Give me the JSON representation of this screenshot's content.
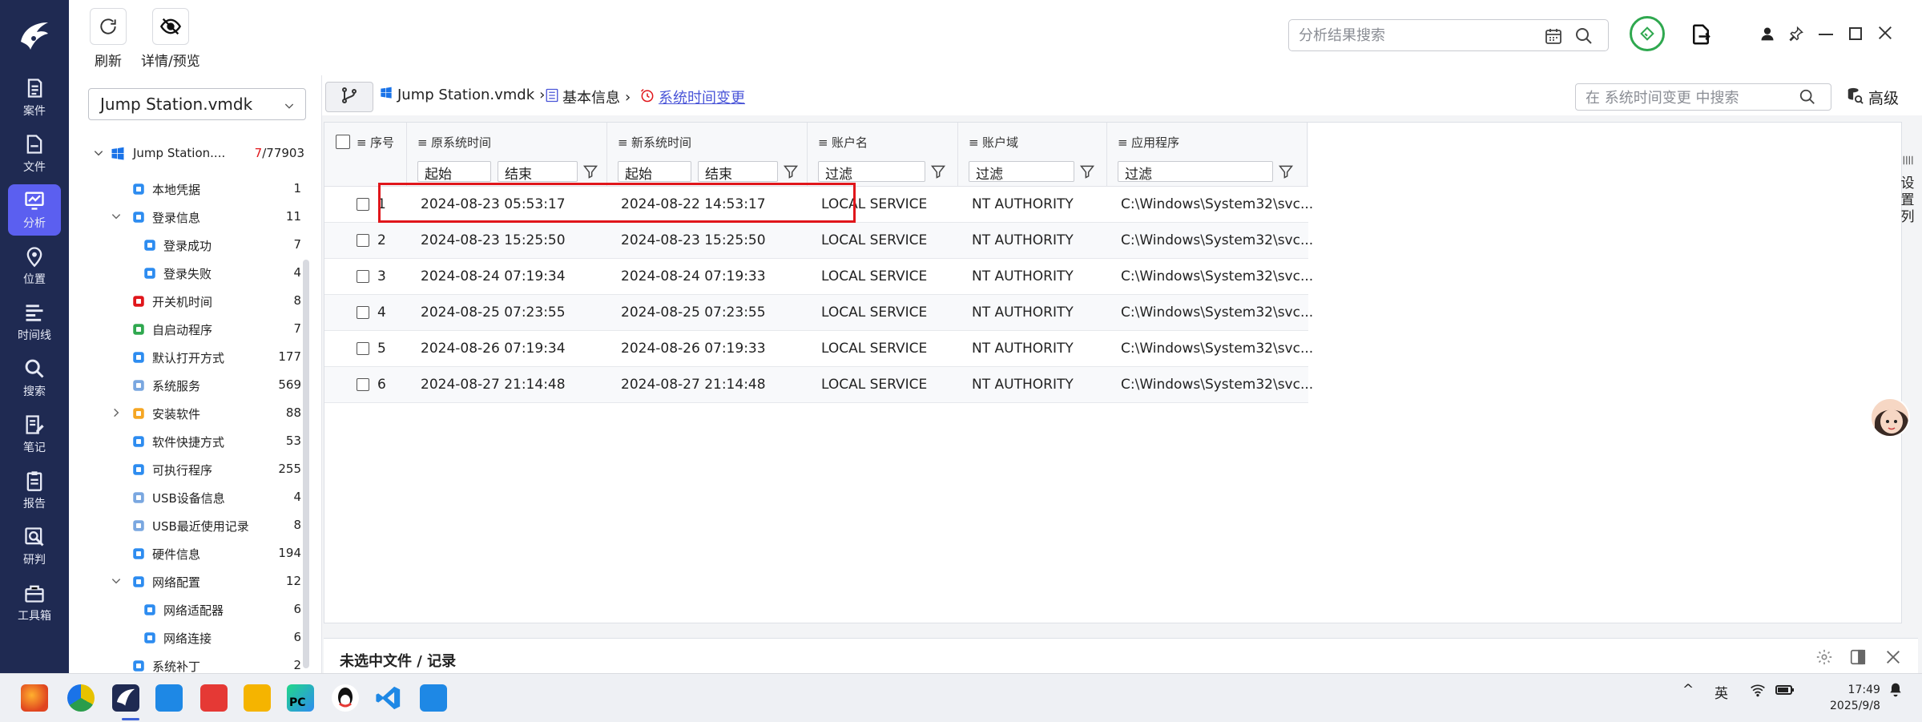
{
  "nav": {
    "items": [
      {
        "label": "案件",
        "icon": "case-icon"
      },
      {
        "label": "文件",
        "icon": "file-icon"
      },
      {
        "label": "分析",
        "icon": "analysis-icon",
        "active": true
      },
      {
        "label": "位置",
        "icon": "location-icon"
      },
      {
        "label": "时间线",
        "icon": "timeline-icon"
      },
      {
        "label": "搜索",
        "icon": "search-icon"
      },
      {
        "label": "笔记",
        "icon": "note-icon"
      },
      {
        "label": "报告",
        "icon": "report-icon"
      },
      {
        "label": "研判",
        "icon": "judge-icon"
      },
      {
        "label": "工具箱",
        "icon": "toolbox-icon"
      }
    ]
  },
  "toolbar": {
    "refresh_label": "刷新",
    "preview_label": "详情/预览",
    "search_placeholder": "分析结果搜索"
  },
  "tree": {
    "source": "Jump Station.vmdk",
    "root": {
      "label": "Jump Station....",
      "count_selected": "7",
      "count_total": "/77903"
    },
    "items": [
      {
        "label": "本地凭据",
        "count": "1"
      },
      {
        "label": "登录信息",
        "count": "11"
      },
      {
        "label": "登录成功",
        "count": "7"
      },
      {
        "label": "登录失败",
        "count": "4"
      },
      {
        "label": "开关机时间",
        "count": "8"
      },
      {
        "label": "自启动程序",
        "count": "7"
      },
      {
        "label": "默认打开方式",
        "count": "177"
      },
      {
        "label": "系统服务",
        "count": "569"
      },
      {
        "label": "安装软件",
        "count": "88"
      },
      {
        "label": "软件快捷方式",
        "count": "53"
      },
      {
        "label": "可执行程序",
        "count": "255"
      },
      {
        "label": "USB设备信息",
        "count": "4"
      },
      {
        "label": "USB最近使用记录",
        "count": "8"
      },
      {
        "label": "硬件信息",
        "count": "194"
      },
      {
        "label": "网络配置",
        "count": "12"
      },
      {
        "label": "网络适配器",
        "count": "6"
      },
      {
        "label": "网络连接",
        "count": "6"
      },
      {
        "label": "系统补丁",
        "count": "2"
      }
    ]
  },
  "breadcrumb": {
    "source": "Jump Station.vmdk",
    "section": "基本信息",
    "current": "系统时间变更"
  },
  "table_search": {
    "placeholder": "在 系统时间变更 中搜索"
  },
  "advanced_label": "高级",
  "table": {
    "headers": {
      "index": "序号",
      "old_time": "原系统时间",
      "new_time": "新系统时间",
      "account": "账户名",
      "domain": "账户域",
      "app": "应用程序"
    },
    "filters": {
      "start": "起始",
      "end": "结束",
      "filter": "过滤"
    },
    "rows": [
      {
        "index": "1",
        "old_time": "2024-08-23 05:53:17",
        "new_time": "2024-08-22 14:53:17",
        "account": "LOCAL SERVICE",
        "domain": "NT AUTHORITY",
        "app": "C:\\Windows\\System32\\svc..."
      },
      {
        "index": "2",
        "old_time": "2024-08-23 15:25:50",
        "new_time": "2024-08-23 15:25:50",
        "account": "LOCAL SERVICE",
        "domain": "NT AUTHORITY",
        "app": "C:\\Windows\\System32\\svc..."
      },
      {
        "index": "3",
        "old_time": "2024-08-24 07:19:34",
        "new_time": "2024-08-24 07:19:33",
        "account": "LOCAL SERVICE",
        "domain": "NT AUTHORITY",
        "app": "C:\\Windows\\System32\\svc..."
      },
      {
        "index": "4",
        "old_time": "2024-08-25 07:23:55",
        "new_time": "2024-08-25 07:23:55",
        "account": "LOCAL SERVICE",
        "domain": "NT AUTHORITY",
        "app": "C:\\Windows\\System32\\svc..."
      },
      {
        "index": "5",
        "old_time": "2024-08-26 07:19:34",
        "new_time": "2024-08-26 07:19:33",
        "account": "LOCAL SERVICE",
        "domain": "NT AUTHORITY",
        "app": "C:\\Windows\\System32\\svc..."
      },
      {
        "index": "6",
        "old_time": "2024-08-27 21:14:48",
        "new_time": "2024-08-27 21:14:48",
        "account": "LOCAL SERVICE",
        "domain": "NT AUTHORITY",
        "app": "C:\\Windows\\System32\\svc..."
      }
    ]
  },
  "settings_col_label": [
    "设",
    "置",
    "列"
  ],
  "bottom_panel": {
    "title": "未选中文件 / 记录"
  },
  "taskbar": {
    "ime": "英",
    "time": "17:49",
    "date": "2025/9/8"
  },
  "colors": {
    "rail_bg": "#1f2a52",
    "active": "#5b5ff0",
    "highlight_red": "#e0161b",
    "link": "#4a55d8"
  }
}
